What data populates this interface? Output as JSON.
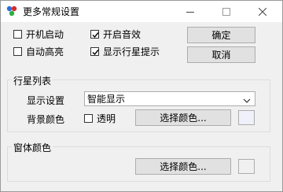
{
  "window": {
    "title": "更多常规设置",
    "minimize": "─",
    "maximize": "☐",
    "close": "✕"
  },
  "options": {
    "startup": {
      "label": "开机启动",
      "checked": false
    },
    "sound": {
      "label": "开启音效",
      "checked": true
    },
    "auto_highlight": {
      "label": "自动高亮",
      "checked": false
    },
    "show_star_tip": {
      "label": "显示行星提示",
      "checked": true
    }
  },
  "buttons": {
    "ok": "确定",
    "cancel": "取消"
  },
  "planet_list": {
    "group_label": "行星列表",
    "display_label": "显示设置",
    "display_value": "智能显示",
    "bg_color_label": "背景颜色",
    "transparent": {
      "label": "透明",
      "checked": false
    },
    "choose_color": "选择颜色...",
    "swatch_color": "#f0f0fa"
  },
  "window_color": {
    "group_label": "窗体颜色",
    "choose_color": "选择颜色...",
    "swatch_color": "#f0f0f0"
  }
}
